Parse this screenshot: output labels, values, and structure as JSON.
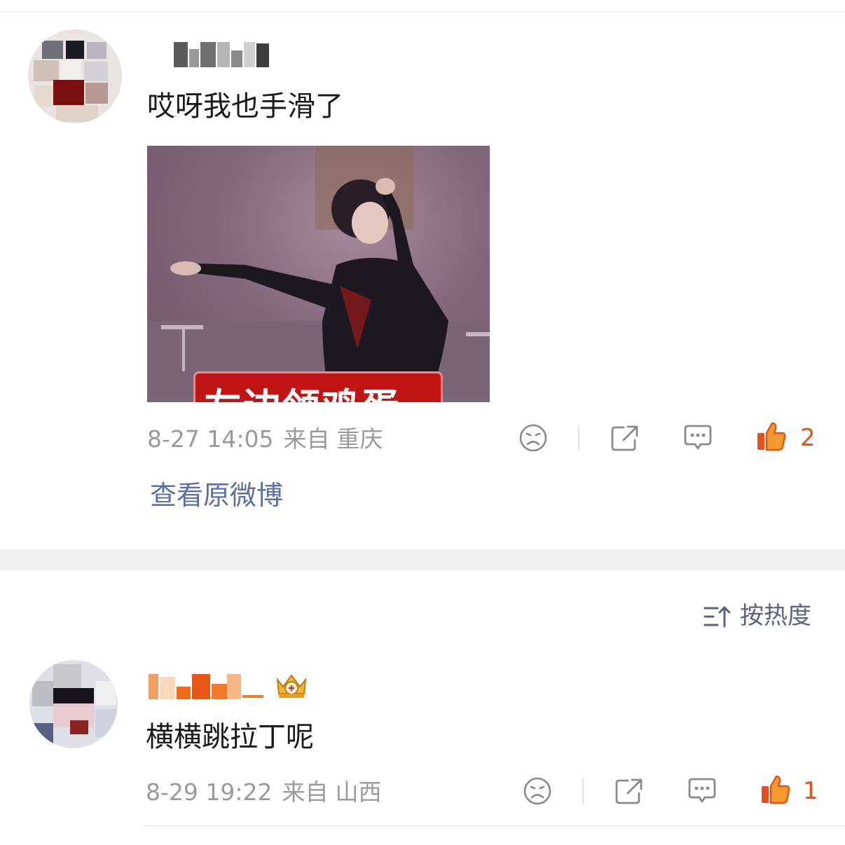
{
  "comments": [
    {
      "text": "哎呀我也手滑了",
      "date": "8-27 14:05",
      "source_prefix": "来自",
      "location": "重庆",
      "like_count": "2",
      "image_caption": "左边领鸡蛋"
    },
    {
      "text": "横横跳拉丁呢",
      "date": "8-29 19:22",
      "source_prefix": "来自",
      "location": "山西",
      "like_count": "1"
    }
  ],
  "view_original_link": "查看原微博",
  "sort": {
    "label": "按热度"
  },
  "colors": {
    "like_accent": "#e2531b",
    "link": "#5b6fa3",
    "meta_text": "#9a9a9a",
    "separator": "#efefef"
  },
  "icons": [
    "dislike-face-icon",
    "share-icon",
    "comment-icon",
    "thumbs-up-icon",
    "sort-icon",
    "crown-badge-icon"
  ]
}
